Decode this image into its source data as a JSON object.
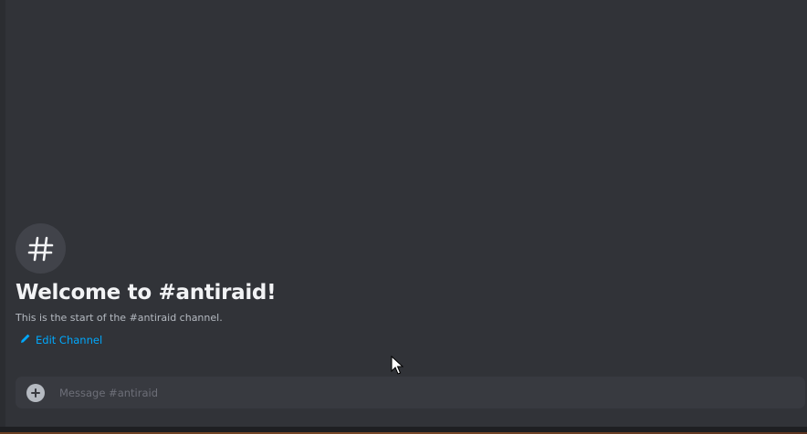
{
  "channel": {
    "name": "antiraid",
    "welcome_title": "Welcome to #antiraid!",
    "welcome_subtitle": "This is the start of the #antiraid channel.",
    "edit_label": "Edit Channel",
    "hero_icon": "hash-icon"
  },
  "composer": {
    "placeholder": "Message #antiraid",
    "attach_icon": "plus-circle-icon"
  },
  "colors": {
    "background": "#313338",
    "accent_link": "#00a8fc",
    "title": "#f2f3f5",
    "muted_text": "#b5bac1",
    "composer_bg": "#383a40"
  }
}
